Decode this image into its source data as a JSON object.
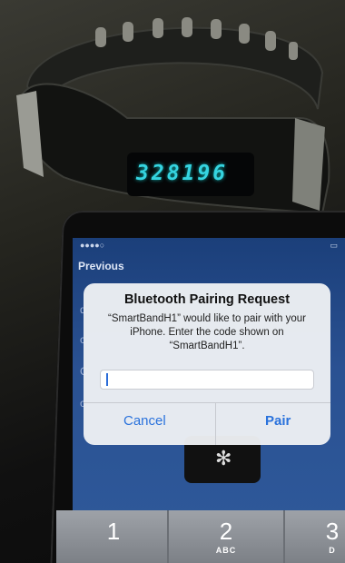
{
  "band": {
    "display_code": "328196"
  },
  "ios": {
    "nav_back": "Previous",
    "list_letters": [
      "d",
      "c",
      "C",
      "c"
    ]
  },
  "dialog": {
    "title": "Bluetooth Pairing Request",
    "message": "“SmartBandH1” would like to pair with your iPhone. Enter the code shown on “SmartBandH1”.",
    "cancel_label": "Cancel",
    "pair_label": "Pair"
  },
  "keypad": [
    {
      "number": "1",
      "letters": ""
    },
    {
      "number": "2",
      "letters": "ABC"
    },
    {
      "number": "3",
      "letters": "D"
    }
  ],
  "colors": {
    "band_digits": "#35d4e0",
    "ios_link": "#2a72dc"
  }
}
